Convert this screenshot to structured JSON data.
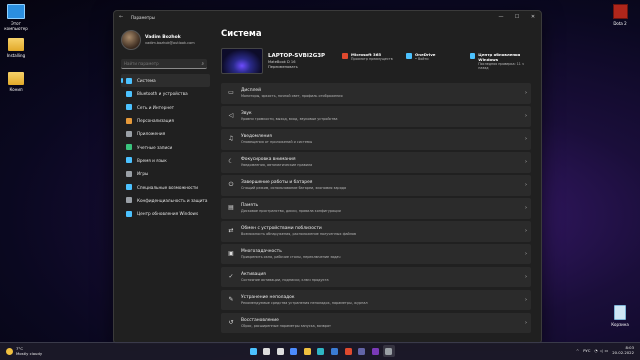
{
  "desktop": {
    "icons": [
      {
        "label": "Этот компьютер",
        "type": "pc"
      },
      {
        "label": "Installing",
        "type": "folder"
      },
      {
        "label": "Конип",
        "type": "folder"
      }
    ],
    "right_icons": [
      {
        "label": "Dota 2",
        "type": "dota"
      },
      {
        "label": "Корзина",
        "type": "bin"
      }
    ]
  },
  "window": {
    "title": "Параметры",
    "controls": [
      "—",
      "☐",
      "✕"
    ]
  },
  "profile": {
    "name": "Vadim Bozhok",
    "email": "vadim.bozhok@outlook.com"
  },
  "search": {
    "value": "",
    "placeholder": "Найти параметр"
  },
  "nav": [
    {
      "label": "Система",
      "icon": "monitor-icon",
      "color": "#4cc2ff"
    },
    {
      "label": "Bluetooth и устройства",
      "icon": "bluetooth-icon",
      "color": "#4cc2ff"
    },
    {
      "label": "Сеть и Интернет",
      "icon": "network-icon",
      "color": "#4cc2ff"
    },
    {
      "label": "Персонализация",
      "icon": "brush-icon",
      "color": "#e69a3a"
    },
    {
      "label": "Приложения",
      "icon": "apps-icon",
      "color": "#9aa0a6"
    },
    {
      "label": "Учетные записи",
      "icon": "person-icon",
      "color": "#3ac47d"
    },
    {
      "label": "Время и язык",
      "icon": "globe-clock-icon",
      "color": "#4cc2ff"
    },
    {
      "label": "Игры",
      "icon": "gamepad-icon",
      "color": "#9aa0a6"
    },
    {
      "label": "Специальные возможности",
      "icon": "accessibility-icon",
      "color": "#4cc2ff"
    },
    {
      "label": "Конфиденциальность и защита",
      "icon": "shield-icon",
      "color": "#9aa0a6"
    },
    {
      "label": "Центр обновления Windows",
      "icon": "update-icon",
      "color": "#4cc2ff"
    }
  ],
  "main": {
    "title": "Система",
    "device": {
      "name": "LAPTOP-SVBI2G3P",
      "model": "MateBook D 16",
      "rename": "Переименовать"
    },
    "tiles": [
      {
        "title": "Microsoft 365",
        "sub": "Просмотр преимуществ",
        "icon": "office-icon",
        "color": "#e0492e"
      },
      {
        "title": "OneDrive",
        "sub": "• Войти",
        "icon": "cloud-icon",
        "color": "#4cc2ff"
      },
      {
        "title": "Центр обновления Windows",
        "sub": "Последняя проверка: 11 ч назад",
        "icon": "update-icon",
        "color": "#4cc2ff"
      }
    ],
    "settings": [
      {
        "title": "Дисплей",
        "sub": "Мониторы, яркость, ночной свет, профиль отображения",
        "icon": "display-icon"
      },
      {
        "title": "Звук",
        "sub": "Уровни громкости, выход, вход, звуковые устройства",
        "icon": "speaker-icon"
      },
      {
        "title": "Уведомления",
        "sub": "Оповещения от приложений и системы",
        "icon": "bell-icon"
      },
      {
        "title": "Фокусировка внимания",
        "sub": "Уведомления, автоматические правила",
        "icon": "moon-icon"
      },
      {
        "title": "Завершение работы и батарея",
        "sub": "Спящий режим, использование батареи, экономия заряда",
        "icon": "power-icon"
      },
      {
        "title": "Память",
        "sub": "Дисковое пространство, диски, правила конфигурации",
        "icon": "storage-icon"
      },
      {
        "title": "Обмен с устройствами поблизости",
        "sub": "Возможность обнаружения, расположение полученных файлов",
        "icon": "share-icon"
      },
      {
        "title": "Многозадачность",
        "sub": "Прикрепить окна, рабочие столы, переключение задач",
        "icon": "multitask-icon"
      },
      {
        "title": "Активация",
        "sub": "Состояние активации, подписки, ключ продукта",
        "icon": "key-icon"
      },
      {
        "title": "Устранение неполадок",
        "sub": "Рекомендуемые средства устранения неполадок, параметры, журнал",
        "icon": "wrench-icon"
      },
      {
        "title": "Восстановление",
        "sub": "Сброс, расширенные параметры запуска, возврат",
        "icon": "recovery-icon"
      }
    ]
  },
  "taskbar": {
    "weather_temp": "7°C",
    "weather_desc": "Mostly cloudy",
    "apps": [
      "windows-logo-icon",
      "search-icon",
      "task-view-icon",
      "widgets-icon",
      "explorer-icon",
      "edge-icon",
      "store-icon",
      "chrome-icon",
      "teams-icon",
      "vegas-icon",
      "settings-icon"
    ],
    "lang": "РУС",
    "time": "8:03",
    "date": "20.02.2022"
  }
}
